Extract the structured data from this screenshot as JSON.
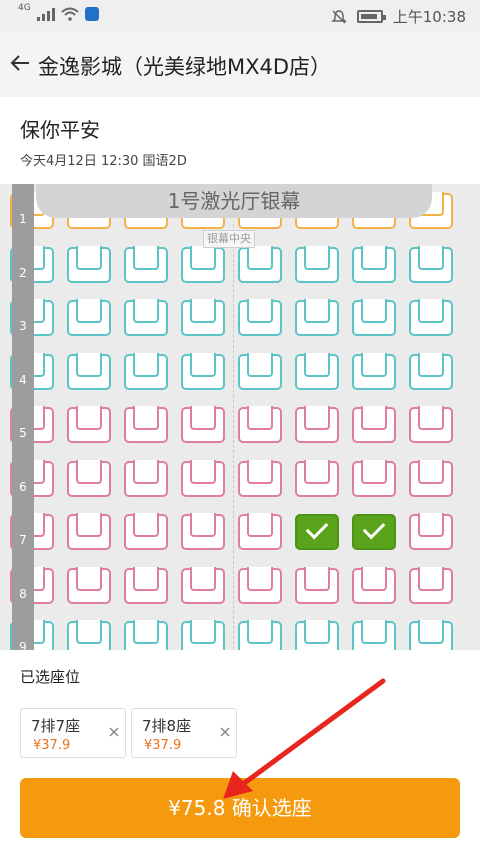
{
  "status_bar": {
    "network": "4G",
    "time": "上午10:38"
  },
  "header": {
    "title": "金逸影城（光美绿地MX4D店）"
  },
  "movie": {
    "title": "保你平安",
    "meta": "今天4月12日  12:30  国语2D"
  },
  "screen": {
    "name": "1号激光厅银幕",
    "center_label": "银幕中央"
  },
  "rows": [
    "1",
    "2",
    "3",
    "4",
    "5",
    "6",
    "7",
    "8",
    "9"
  ],
  "seat_grid": {
    "row_colors": [
      "orange",
      "cyan",
      "cyan",
      "cyan",
      "pink",
      "pink",
      "pink",
      "pink",
      "cyan"
    ],
    "seats_per_row": 8,
    "selected": [
      [
        7,
        5
      ],
      [
        7,
        6
      ]
    ]
  },
  "selection": {
    "label": "已选座位",
    "tickets": [
      {
        "seat": "7排7座",
        "price": "¥37.9"
      },
      {
        "seat": "7排8座",
        "price": "¥37.9"
      }
    ]
  },
  "confirm": {
    "label": "¥75.8 确认选座"
  },
  "colors": {
    "accent": "#f59a0f",
    "selected_seat": "#59a41a",
    "cyan_seat": "#5cc3c6",
    "pink_seat": "#df7f99",
    "orange_seat": "#f2b24a",
    "price": "#e8731e",
    "arrow": "#e8261e"
  }
}
